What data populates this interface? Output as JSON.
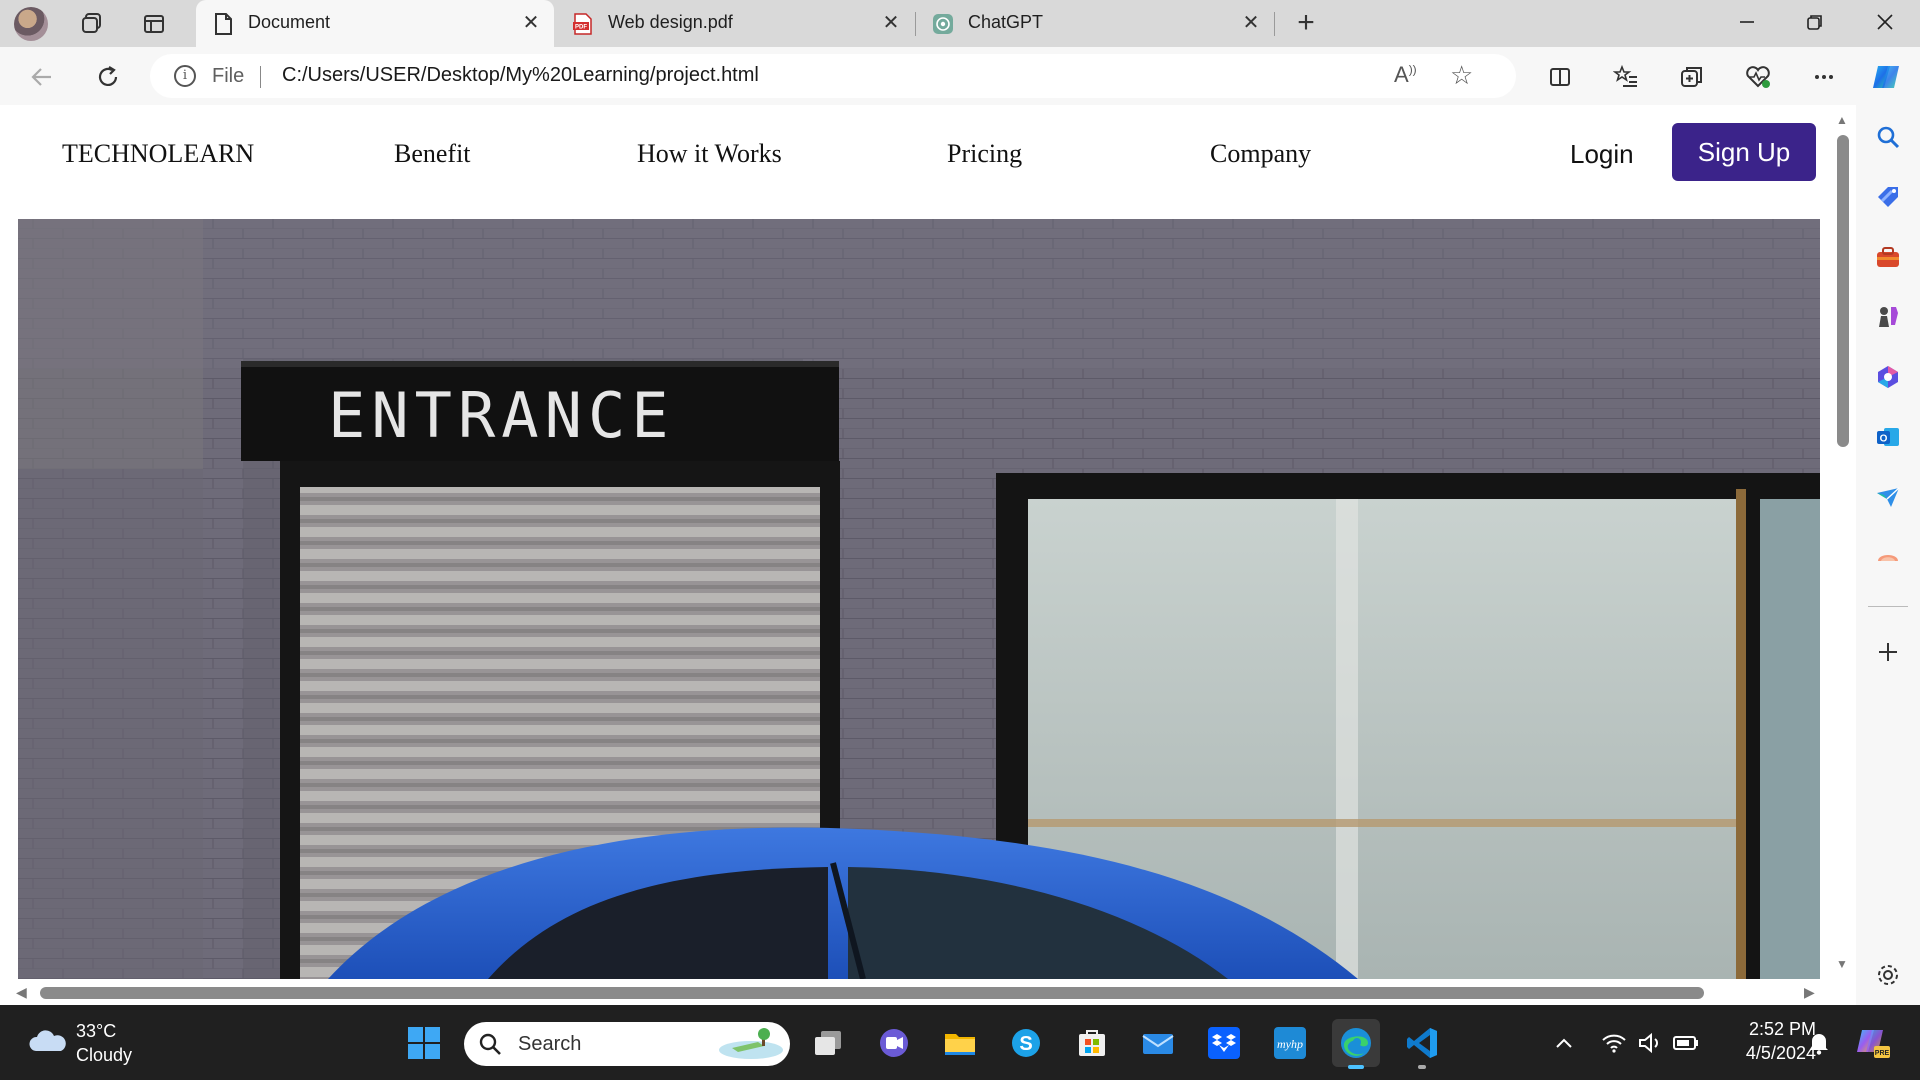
{
  "browser": {
    "tabs": [
      {
        "title": "Document",
        "active": true
      },
      {
        "title": "Web design.pdf",
        "active": false
      },
      {
        "title": "ChatGPT",
        "active": false
      }
    ],
    "address": {
      "scheme": "File",
      "url": "C:/Users/USER/Desktop/My%20Learning/project.html"
    },
    "read_aloud_label": "A"
  },
  "site": {
    "brand": "TECHNOLEARN",
    "nav": [
      "Benefit",
      "How it Works",
      "Pricing",
      "Company"
    ],
    "login_label": "Login",
    "signup_label": "Sign Up",
    "signup_color": "#3b238a",
    "hero": {
      "sign_text": "ENTRANCE"
    }
  },
  "taskbar": {
    "weather": {
      "temp": "33°C",
      "condition": "Cloudy"
    },
    "search_placeholder": "Search",
    "clock": {
      "time": "2:52 PM",
      "date": "4/5/2024"
    },
    "copilot_badge": "PRE"
  }
}
